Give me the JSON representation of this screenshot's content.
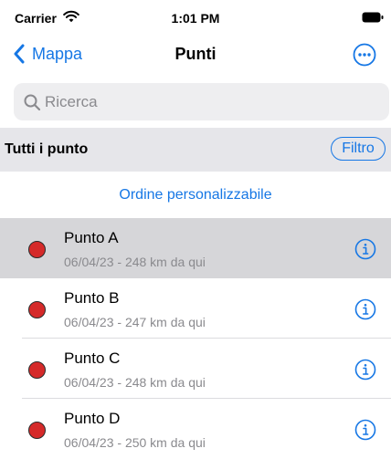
{
  "status_bar": {
    "carrier": "Carrier",
    "time": "1:01 PM",
    "icons": [
      "wifi-icon",
      "battery-icon"
    ]
  },
  "nav": {
    "back_label": "Mappa",
    "title": "Punti",
    "more_icon": "ellipsis-circle-icon"
  },
  "search": {
    "placeholder": "Ricerca",
    "value": ""
  },
  "section": {
    "title": "Tutti i punto",
    "filter_label": "Filtro"
  },
  "custom_order_label": "Ordine personalizzabile",
  "points": [
    {
      "name": "Punto A",
      "detail": "06/04/23 - 248 km da qui",
      "selected": true
    },
    {
      "name": "Punto B",
      "detail": "06/04/23 - 247 km da qui",
      "selected": false
    },
    {
      "name": "Punto C",
      "detail": "06/04/23 - 248 km da qui",
      "selected": false
    },
    {
      "name": "Punto D",
      "detail": "06/04/23 - 250 km da qui",
      "selected": false
    }
  ],
  "colors": {
    "accent": "#1677e5",
    "marker": "#d52a2a",
    "selected_row": "#d6d6d9",
    "section_bg": "#e6e6ea"
  }
}
